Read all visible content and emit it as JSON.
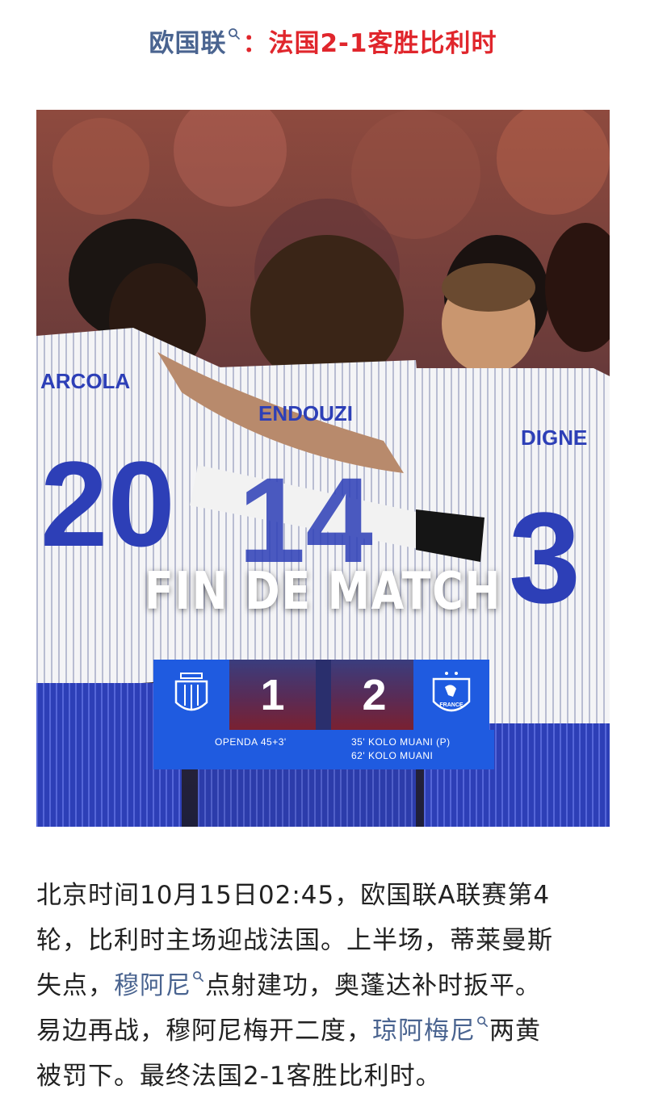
{
  "headline": {
    "tag": "欧国联",
    "separator": "：",
    "title": "法国2-1客胜比利时"
  },
  "photo": {
    "banner": "FIN DE MATCH",
    "jersey_names": [
      "ARCOLA",
      "ENDOUZI",
      "DIGNE"
    ],
    "jersey_numbers": [
      "20",
      "14",
      "3"
    ],
    "home_score": "1",
    "away_score": "2",
    "home_scorers": [
      "OPENDA 45+3'"
    ],
    "away_scorers": [
      "35' KOLO MUANI (P)",
      "62' KOLO MUANI"
    ],
    "away_crest_text": "FRANCE"
  },
  "article": {
    "line1": "北京时间10月15日02:45，欧国联A联赛第4",
    "line2": "轮，比利时主场迎战法国。上半场，蒂莱曼斯",
    "line3_a": "失点，",
    "line3_link": "穆阿尼",
    "line3_b": "点射建功，奥蓬达补时扳平。",
    "line4_a": "易边再战，穆阿尼梅开二度，",
    "line4_link": "琼阿梅尼",
    "line4_b": "两黄",
    "line5": "被罚下。最终法国2-1客胜比利时。"
  },
  "colors": {
    "link": "#4a6490",
    "headline_red": "#e0262c",
    "panel_blue": "#1f5be0"
  },
  "icons": [
    "search-icon",
    "belgium-crest-icon",
    "france-crest-icon"
  ]
}
